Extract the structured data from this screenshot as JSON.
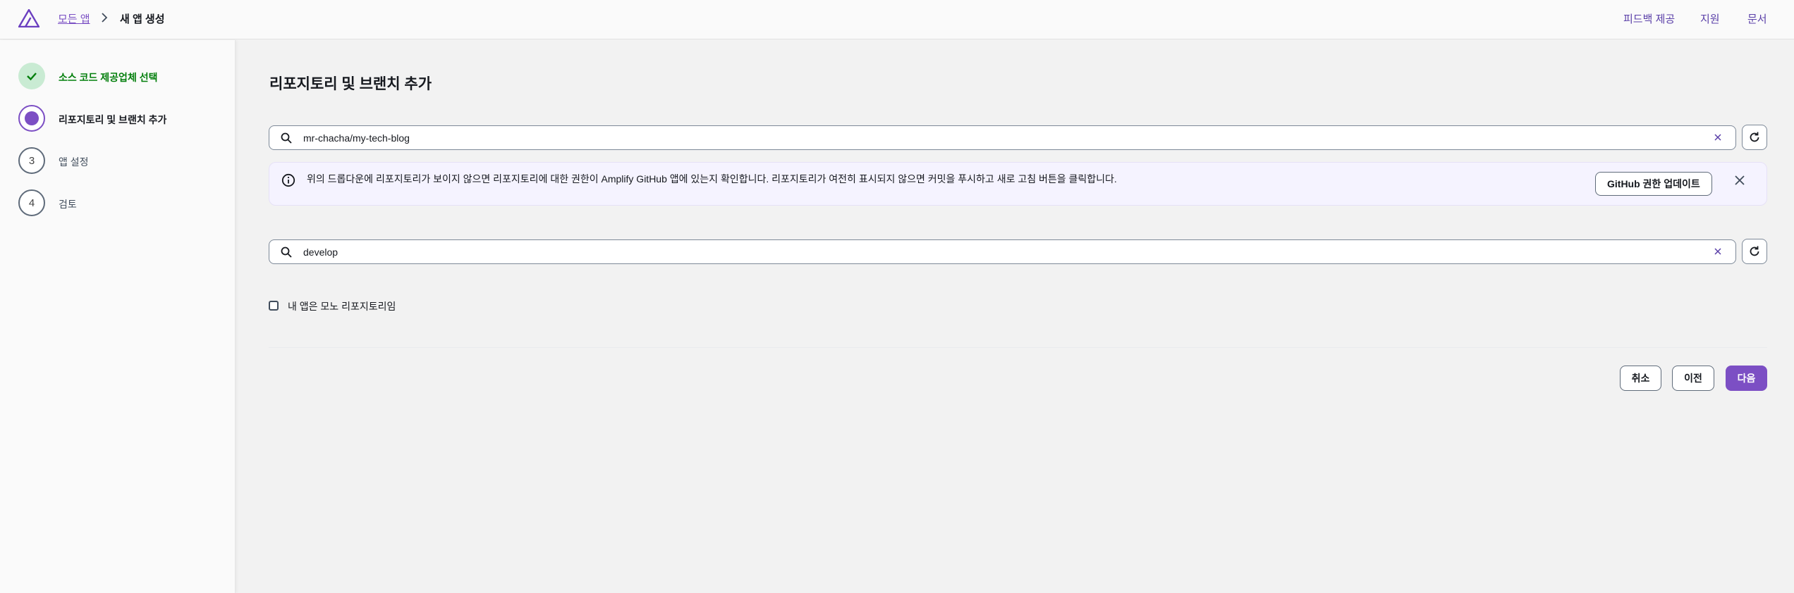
{
  "header": {
    "logo_icon": "amplify-logo-icon",
    "breadcrumb": {
      "parent_label": "모든 앱",
      "separator_icon": "chevron-right-icon",
      "current_label": "새 앱 생성"
    },
    "links": {
      "feedback": "피드백 제공",
      "support": "지원",
      "docs": "문서"
    }
  },
  "steps": [
    {
      "number": "1",
      "label": "소스 코드 제공업체 선택",
      "status": "done",
      "icon": "check-icon"
    },
    {
      "number": "2",
      "label": "리포지토리 및 브랜치 추가",
      "status": "active"
    },
    {
      "number": "3",
      "label": "앱 설정",
      "status": "pending"
    },
    {
      "number": "4",
      "label": "검토",
      "status": "pending"
    }
  ],
  "main": {
    "title": "리포지토리 및 브랜치 추가",
    "repository_select": {
      "value": "mr-chacha/my-tech-blog",
      "search_icon": "search-icon",
      "clear_icon": "close-icon",
      "refresh_icon": "refresh-icon"
    },
    "alert": {
      "icon": "info-icon",
      "text": "위의 드롭다운에 리포지토리가 보이지 않으면 리포지토리에 대한 권한이 Amplify GitHub 앱에 있는지 확인합니다. 리포지토리가 여전히 표시되지 않으면 커밋을 푸시하고 새로 고침 버튼을 클릭합니다.",
      "button_label": "GitHub 권한 업데이트",
      "close_icon": "close-icon"
    },
    "branch_select": {
      "value": "develop",
      "search_icon": "search-icon",
      "clear_icon": "close-icon",
      "refresh_icon": "refresh-icon"
    },
    "monorepo_checkbox": {
      "label": "내 앱은 모노 리포지토리임",
      "checked": false
    }
  },
  "footer": {
    "cancel_label": "취소",
    "previous_label": "이전",
    "next_label": "다음"
  },
  "colors": {
    "accent": "#7c4fc4",
    "link": "#7a4fc4",
    "success": "#037f0c",
    "success_bg": "#c9ebd3",
    "info_bg": "#f5f3ff"
  }
}
